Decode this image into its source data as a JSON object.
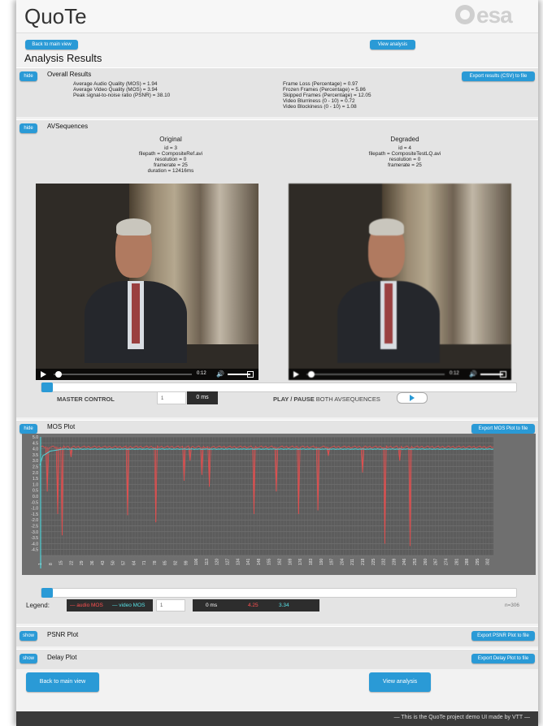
{
  "app": {
    "title": "QuoTe",
    "logo_text": "esa"
  },
  "nav": {
    "back_label": "Back to main view",
    "view_label": "View analysis"
  },
  "page_title": "Analysis Results",
  "overall": {
    "toggle": "hide",
    "title": "Overall Results",
    "export": "Export results (CSV) to file",
    "left": [
      "Average Audio Quality (MOS) = 1.94",
      "Average Video Quality (MOS) = 3.94",
      "Peak signal-to-noise ratio (PSNR) = 38.10"
    ],
    "right": [
      "Frame Loss (Percentage) = 0.97",
      "Frozen Frames (Percentage) = 5.86",
      "Skipped Frames (Percentage) = 12.05",
      "Video Blurriness (0 - 10) = 0.72",
      "Video Blockiness (0 - 10) = 1.08"
    ]
  },
  "avseq": {
    "toggle": "hide",
    "title": "AVSequences",
    "original": {
      "heading": "Original",
      "lines": [
        "id = 3",
        "filepath = CompositeRef.avi",
        "resolution = 0",
        "framerate = 25",
        "duration = 12416ms"
      ],
      "time": "0:12"
    },
    "degraded": {
      "heading": "Degraded",
      "lines": [
        "id = 4",
        "filepath = CompositeTestLQ.avi",
        "resolution = 0",
        "framerate = 25"
      ],
      "time": "0:12"
    },
    "master_label": "MASTER CONTROL",
    "master_value": "1",
    "master_time": "0 ms",
    "play_pause_bold": "PLAY / PAUSE",
    "play_pause_rest": " BOTH AVSEQUENCES",
    "master_progress": 0.0
  },
  "mos": {
    "toggle": "hide",
    "title": "MOS Plot",
    "export": "Export MOS Plot to file",
    "legend_label": "Legend:",
    "legend_audio": "— audio MOS",
    "legend_video": "— video MOS",
    "frame_value": "1",
    "time": "0 ms",
    "audio_value": "4.25",
    "video_value": "3.34",
    "n_label": "n=306",
    "progress": 0.0
  },
  "chart_data": {
    "type": "line",
    "title": "",
    "xlabel": "",
    "ylabel": "",
    "ylim": [
      -5.0,
      5.0
    ],
    "y_ticks": [
      "5.0",
      "4.5",
      "4.0",
      "3.5",
      "3.0",
      "2.5",
      "2.0",
      "1.5",
      "1.0",
      "0.5",
      "0.0",
      "-0.5",
      "-1.0",
      "-1.5",
      "-2.0",
      "-2.5",
      "-3.0",
      "-3.5",
      "-4.0",
      "-4.5"
    ],
    "x_ticks": [
      "1",
      "8",
      "15",
      "22",
      "29",
      "36",
      "43",
      "50",
      "57",
      "64",
      "71",
      "78",
      "85",
      "92",
      "99",
      "106",
      "113",
      "120",
      "127",
      "134",
      "141",
      "148",
      "155",
      "162",
      "169",
      "176",
      "183",
      "190",
      "197",
      "204",
      "211",
      "218",
      "225",
      "232",
      "239",
      "246",
      "253",
      "260",
      "267",
      "274",
      "281",
      "288",
      "295",
      "302"
    ],
    "x_max": 306,
    "grid": true,
    "series": [
      {
        "name": "audio MOS",
        "color": "#e05050",
        "baseline": 4.15,
        "dips": [
          [
            6,
            0.4
          ],
          [
            13,
            -1.5
          ],
          [
            16,
            -3.3
          ],
          [
            22,
            3.3
          ],
          [
            60,
            -1.6
          ],
          [
            79,
            -2.2
          ],
          [
            98,
            1.3
          ],
          [
            102,
            3.0
          ],
          [
            110,
            1.8
          ],
          [
            115,
            0.8
          ],
          [
            145,
            -1.5
          ],
          [
            160,
            0.4
          ],
          [
            175,
            -1.5
          ],
          [
            188,
            -1.2
          ],
          [
            195,
            3.4
          ],
          [
            218,
            2.0
          ],
          [
            233,
            -4.0
          ],
          [
            243,
            3.0
          ],
          [
            250,
            -4.2
          ]
        ]
      },
      {
        "name": "video MOS",
        "color": "#4fd3d8",
        "baseline": 3.97,
        "start": [
          [
            1,
            2.6
          ],
          [
            3,
            3.4
          ],
          [
            8,
            3.8
          ],
          [
            14,
            3.92
          ]
        ]
      }
    ]
  },
  "psnr": {
    "toggle": "show",
    "title": "PSNR Plot",
    "export": "Export PSNR Plot to file"
  },
  "delay": {
    "toggle": "show",
    "title": "Delay Plot",
    "export": "Export Delay Plot to file"
  },
  "footer": "— This is the QuoTe project demo UI made by VTT —"
}
